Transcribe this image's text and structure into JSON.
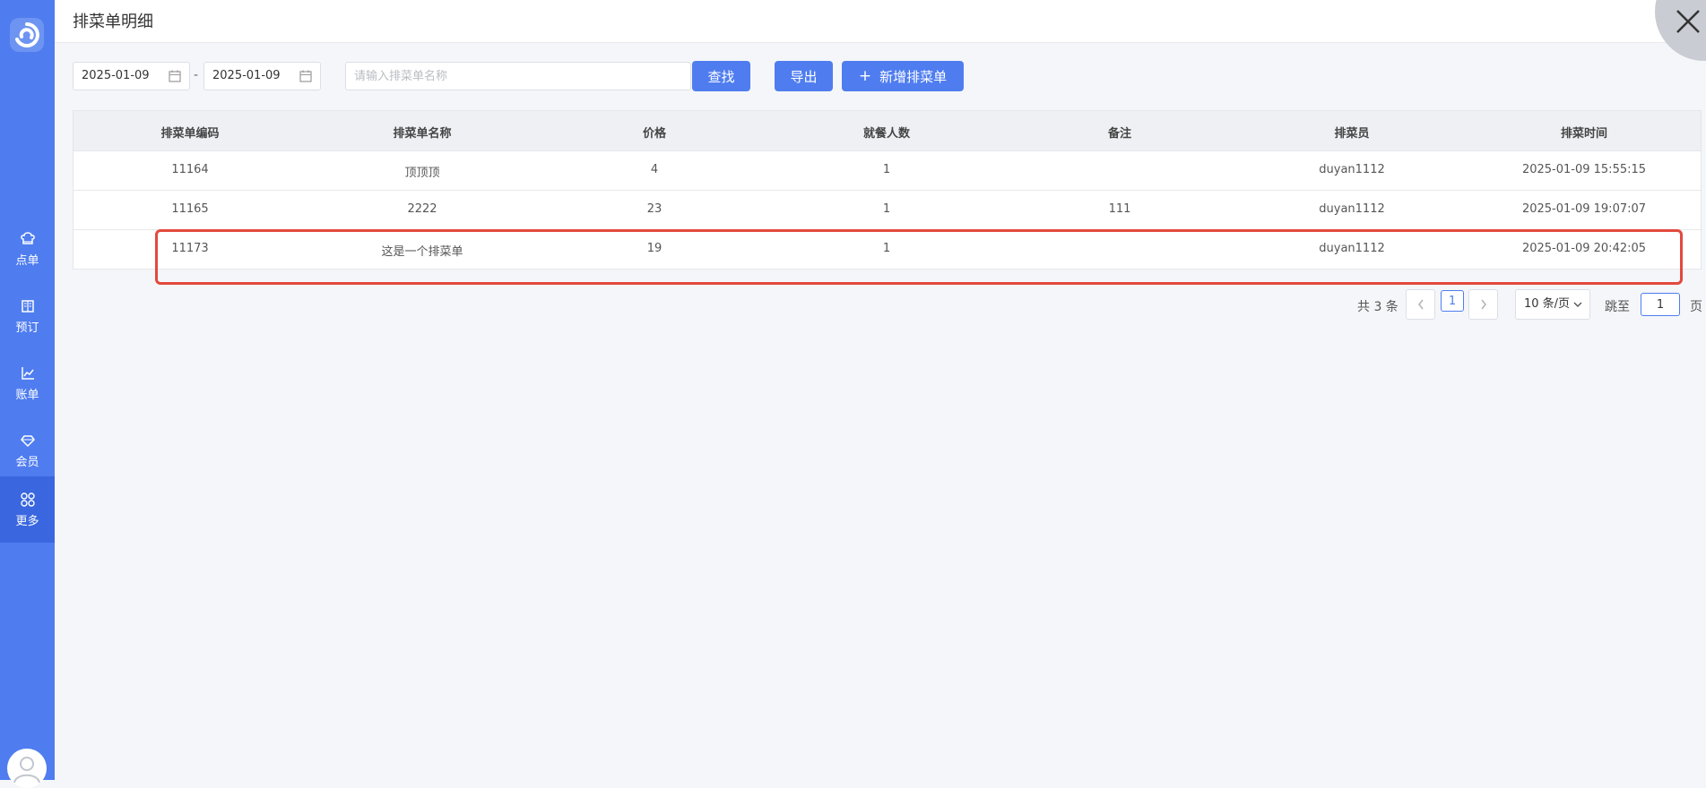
{
  "header": {
    "title": "排菜单明细"
  },
  "sidebar": {
    "items": [
      {
        "label": "点单",
        "icon": "chef-hat-icon"
      },
      {
        "label": "预订",
        "icon": "book-icon"
      },
      {
        "label": "账单",
        "icon": "chart-icon"
      },
      {
        "label": "会员",
        "icon": "diamond-icon"
      },
      {
        "label": "更多",
        "icon": "grid-icon"
      }
    ],
    "active_index": 4
  },
  "toolbar": {
    "start_date": "2025-01-09",
    "date_separator": "-",
    "end_date": "2025-01-09",
    "search_placeholder": "请输入排菜单名称",
    "search_label": "查找",
    "export_label": "导出",
    "add_label": "新增排菜单",
    "add_icon": "+"
  },
  "table": {
    "columns": [
      "排菜单编码",
      "排菜单名称",
      "价格",
      "就餐人数",
      "备注",
      "排菜员",
      "排菜时间"
    ],
    "rows": [
      [
        "11164",
        "顶顶顶",
        "4",
        "1",
        "",
        "duyan1112",
        "2025-01-09 15:55:15"
      ],
      [
        "11165",
        "2222",
        "23",
        "1",
        "111",
        "duyan1112",
        "2025-01-09 19:07:07"
      ],
      [
        "11173",
        "这是一个排菜单",
        "19",
        "1",
        "",
        "duyan1112",
        "2025-01-09 20:42:05"
      ]
    ],
    "highlighted_row": 2
  },
  "pagination": {
    "total_text": "共 3 条",
    "current_page": "1",
    "page_size": "10 条/页",
    "jump_label": "跳至",
    "jump_value": "1",
    "page_suffix": "页"
  },
  "colors": {
    "accent": "#4f7df0",
    "sidebar": "#4f7df0",
    "highlight_border": "#e2493d"
  }
}
